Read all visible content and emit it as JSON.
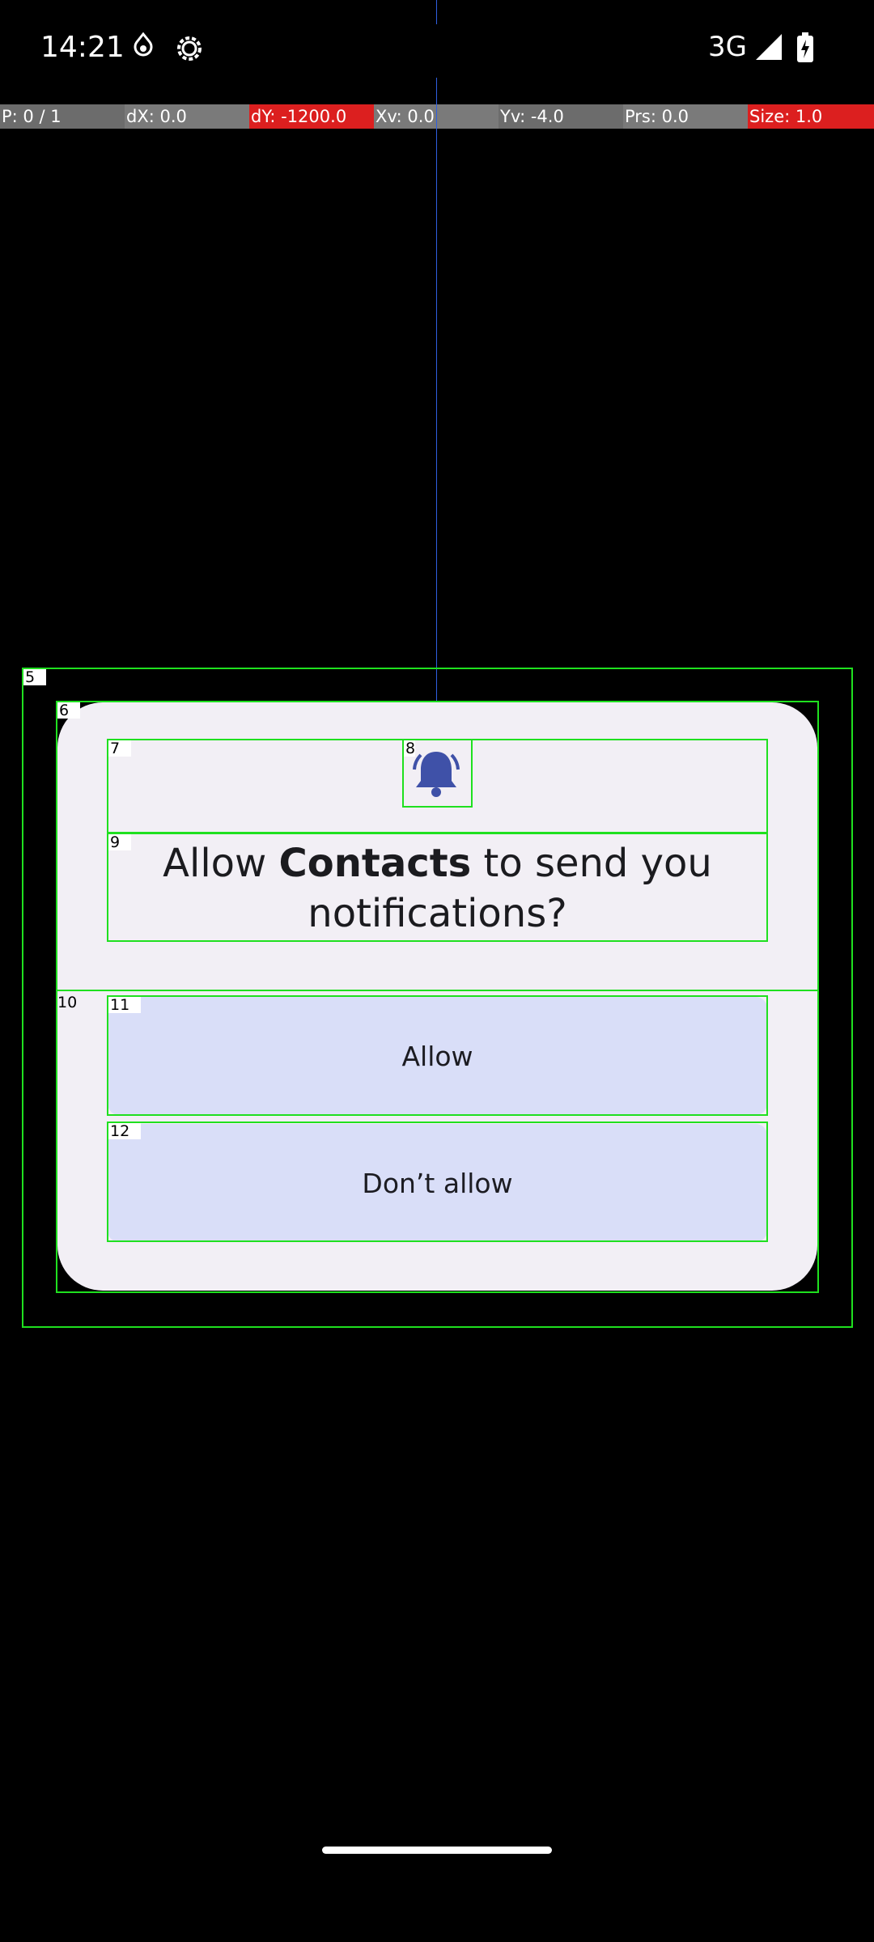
{
  "status_bar": {
    "time": "14:21",
    "network": "3G",
    "icons": [
      "dnd-icon",
      "settings-gear-icon",
      "signal-icon",
      "battery-charging-icon"
    ]
  },
  "pointer_overlay": {
    "cells": [
      "P: 0 / 1",
      "dX: 0.0",
      "dY: -1200.0",
      "Xv: 0.0",
      "Yv: -4.0",
      "Prs: 0.0",
      "Size: 1.0"
    ]
  },
  "dialog": {
    "title_prefix": "Allow ",
    "app_name": "Contacts",
    "title_suffix": " to send you notifications?",
    "allow_label": "Allow",
    "deny_label": "Don’t allow"
  },
  "bounding_box_labels": [
    "5",
    "6",
    "7",
    "8",
    "9",
    "10",
    "11",
    "12"
  ],
  "colors": {
    "highlight_box": "#1fe01f",
    "dialog_bg": "#f2eff5",
    "button_bg": "#d9def8",
    "bell": "#3f51a8"
  }
}
